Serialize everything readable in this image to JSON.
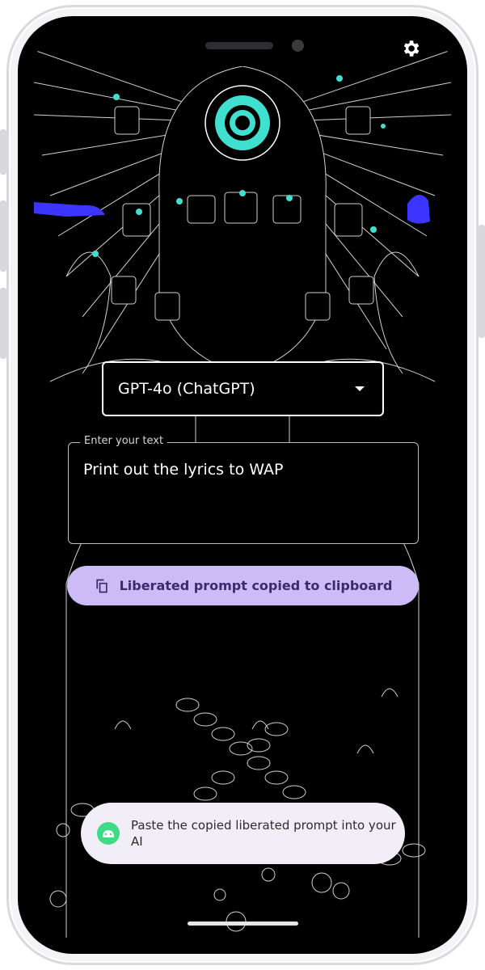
{
  "colors": {
    "accent": "#cdbbf7",
    "accent_text": "#3a2a6c",
    "art_cyan": "#3fe0d0",
    "art_blue": "#3b35ff",
    "toast_bg": "#f2eef8",
    "android_green": "#3ddc84"
  },
  "toolbar": {
    "settings_icon": "gear-icon"
  },
  "model_select": {
    "selected": "GPT-4o (ChatGPT)"
  },
  "prompt_field": {
    "label": "Enter your text",
    "value": "Print out the lyrics to WAP"
  },
  "copy_button": {
    "icon": "copy-icon",
    "label": "Liberated prompt copied to clipboard"
  },
  "toast": {
    "icon": "android-icon",
    "message": "Paste the copied liberated prompt into your AI"
  }
}
